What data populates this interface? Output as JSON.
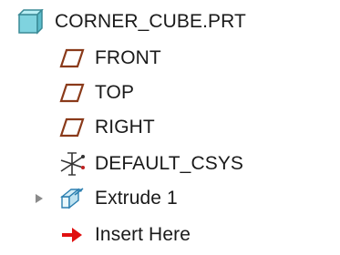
{
  "model_tree": {
    "root": {
      "label": "CORNER_CUBE.PRT",
      "icon": "part-icon"
    },
    "items": [
      {
        "label": "FRONT",
        "icon": "datum-plane-icon"
      },
      {
        "label": "TOP",
        "icon": "datum-plane-icon"
      },
      {
        "label": "RIGHT",
        "icon": "datum-plane-icon"
      },
      {
        "label": "DEFAULT_CSYS",
        "icon": "coordinate-system-icon"
      },
      {
        "label": "Extrude 1",
        "icon": "extrude-icon",
        "expandable": true
      },
      {
        "label": "Insert Here",
        "icon": "insert-here-arrow-icon"
      }
    ]
  },
  "colors": {
    "part_fill": "#7fd3df",
    "part_stroke": "#3a8a96",
    "datum_plane": "#8a3a1a",
    "csys": "#333333",
    "csys_accent": "#c02020",
    "extrude_stroke": "#2c7fb0",
    "insert_arrow": "#e01010"
  }
}
